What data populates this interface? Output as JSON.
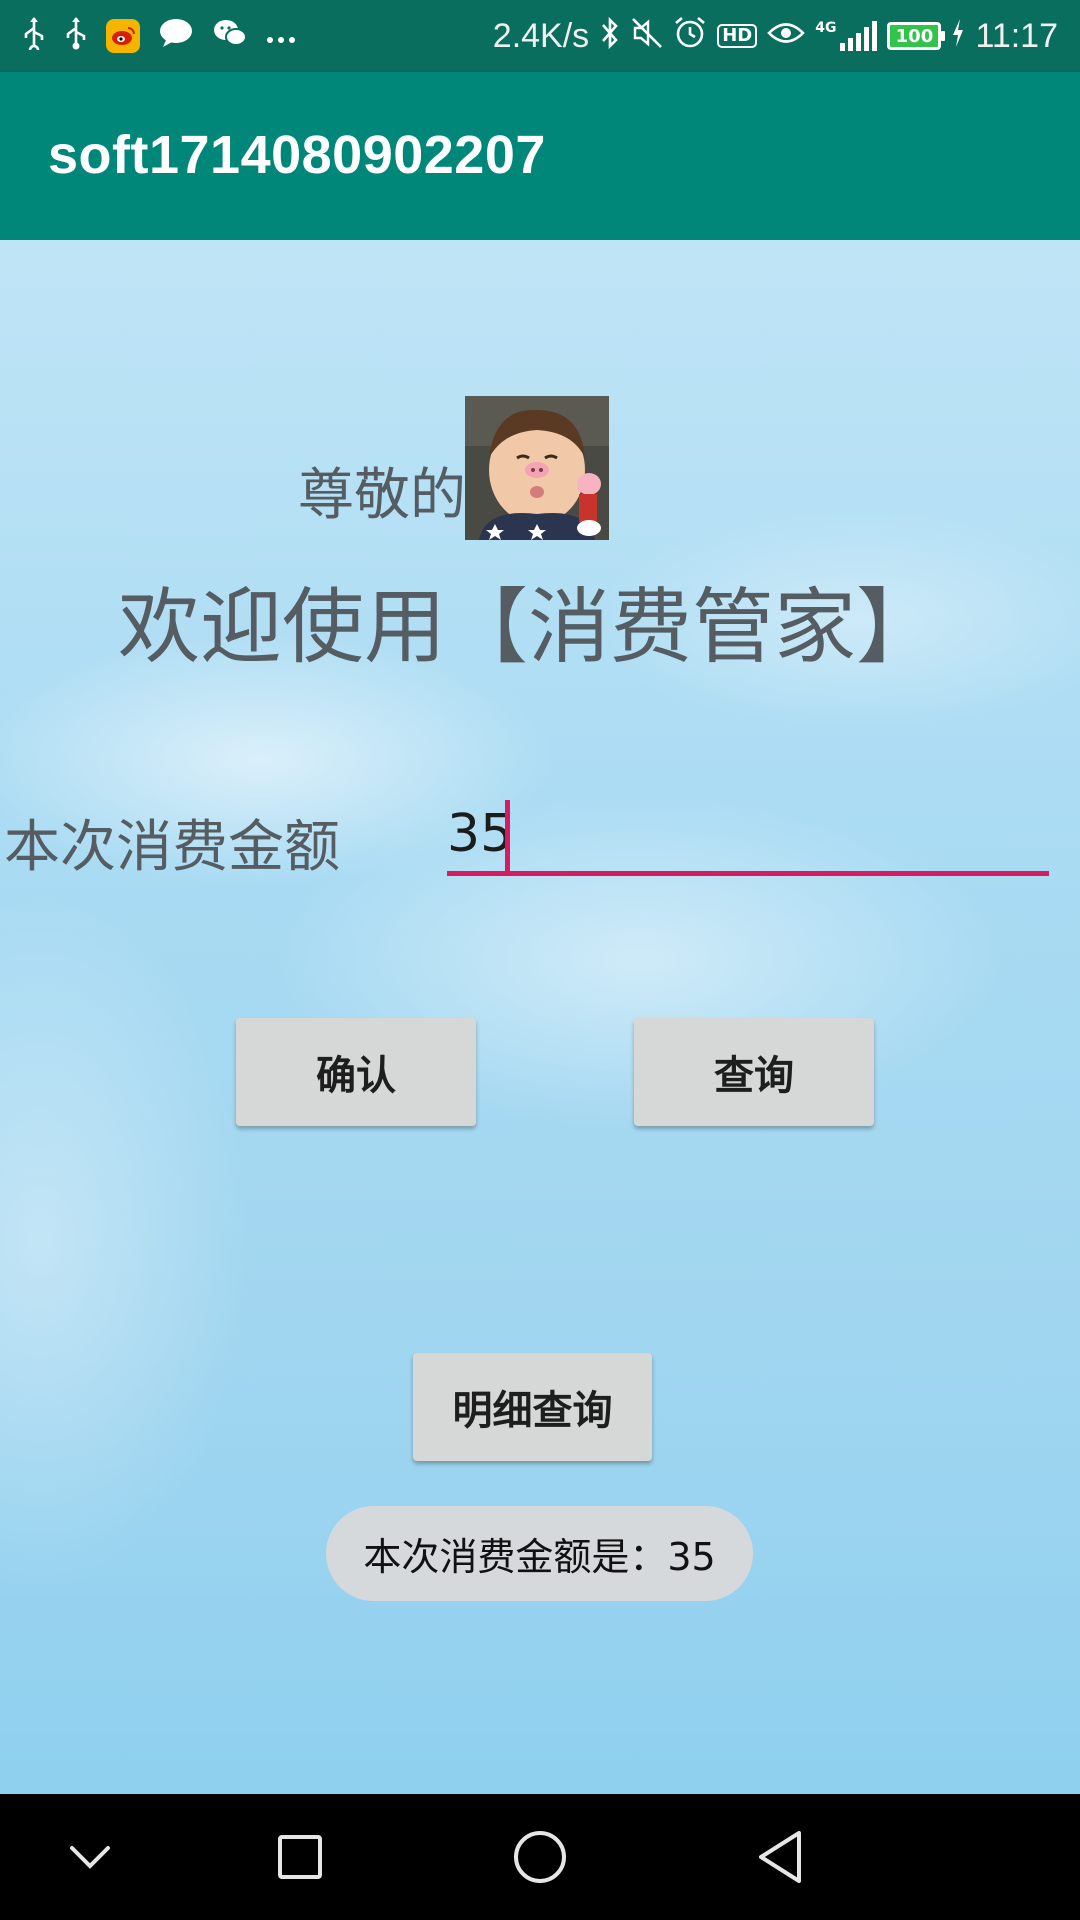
{
  "status_bar": {
    "speed": "2.4K/s",
    "network": "4G",
    "battery": "100",
    "time": "11:17",
    "left_icons": [
      "usb-icon",
      "usb-icon",
      "weibo-icon",
      "message-icon",
      "wechat-icon",
      "more-icon"
    ],
    "right_icons": [
      "bluetooth-icon",
      "mute-icon",
      "alarm-icon",
      "hd-icon",
      "eye-icon",
      "signal-icon",
      "battery-icon",
      "charging-icon"
    ]
  },
  "app_bar": {
    "title": "soft1714080902207"
  },
  "main": {
    "greeting": "尊敬的",
    "welcome": "欢迎使用【消费管家】",
    "amount_label": "本次消费金额",
    "amount_value": "35",
    "confirm_button": "确认",
    "query_button": "查询",
    "detail_button": "明细查询",
    "toast": "本次消费金额是：35"
  },
  "nav_bar": {
    "icons": [
      "chevron-down-icon",
      "recents-square-icon",
      "home-circle-icon",
      "back-triangle-icon"
    ]
  },
  "colors": {
    "status_bar": "#0a6e5e",
    "app_bar": "#00877a",
    "accent": "#d81b60",
    "button": "#d6d7d7",
    "text": "#555c62"
  }
}
